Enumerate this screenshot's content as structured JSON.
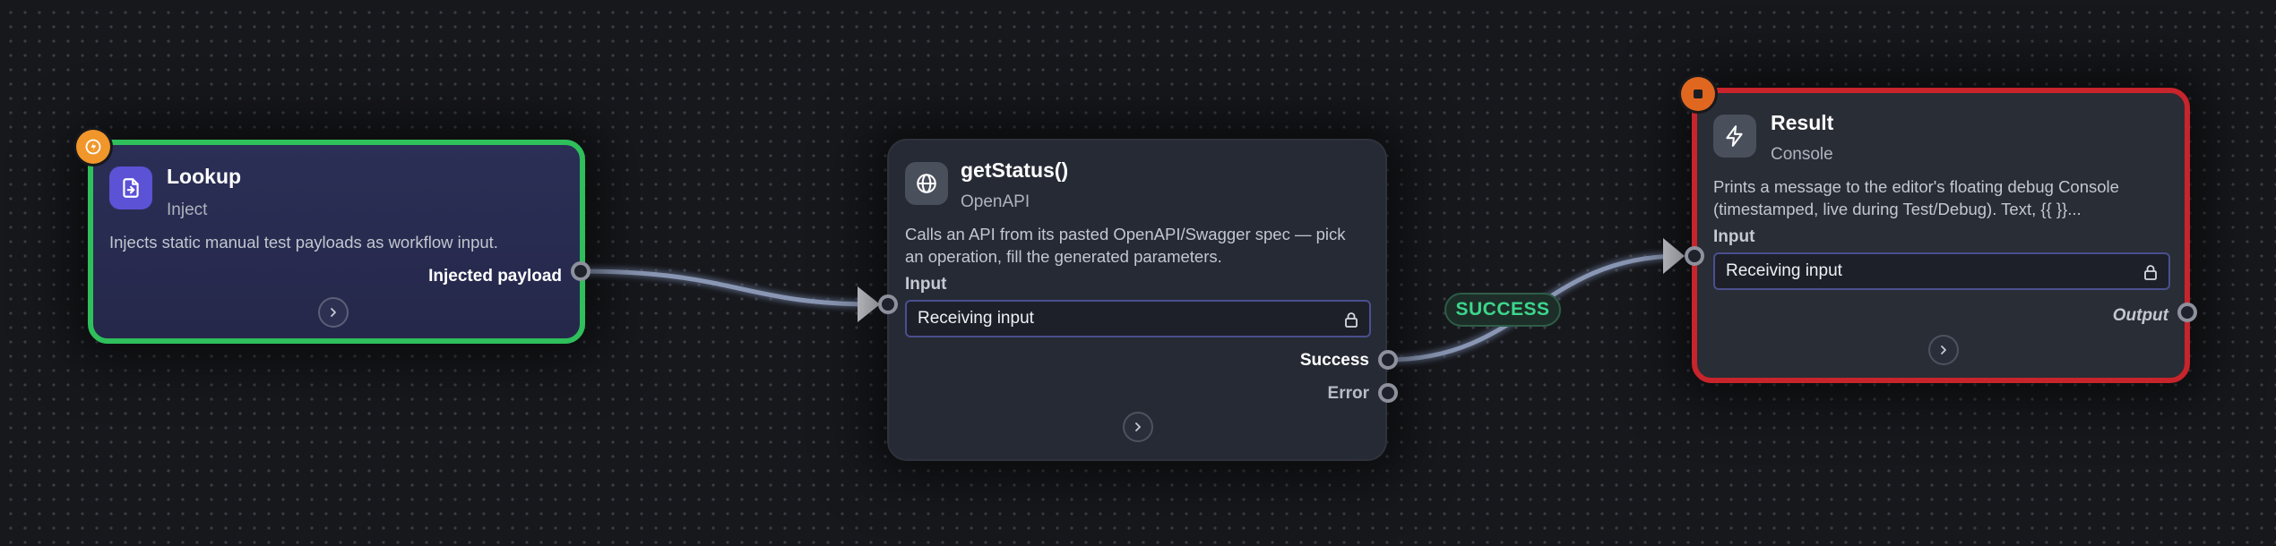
{
  "nodes": {
    "inject": {
      "title": "Lookup",
      "type": "Inject",
      "description": "Injects static manual test payloads as workflow input.",
      "output_label": "Injected payload",
      "icon": "file-import-icon",
      "border_color": "#2fbf5b",
      "badge_icon": "lightning-badge-icon"
    },
    "openapi": {
      "title": "getStatus()",
      "type": "OpenAPI",
      "description_line1": "Calls an API from its pasted OpenAPI/Swagger spec — pick",
      "description_line2": "an operation, fill the generated parameters.",
      "input_label": "Input",
      "input_value": "Receiving input",
      "outputs": [
        "Success",
        "Error"
      ],
      "icon": "globe-icon"
    },
    "console": {
      "title": "Result",
      "type": "Console",
      "description_line1": "Prints a message to the editor's floating debug Console",
      "description_line2": "(timestamped, live during Test/Debug). Text, {{ }}...",
      "input_label": "Input",
      "input_value": "Receiving input",
      "output_label": "Output",
      "icon": "lightning-icon",
      "border_color": "#c8242b",
      "badge_icon": "stop-badge-icon"
    }
  },
  "edges": [
    {
      "from": "Lookup.Injected payload",
      "to": "getStatus().Input"
    },
    {
      "from": "getStatus().Success",
      "to": "Result.Input",
      "label": "SUCCESS"
    }
  ],
  "colors": {
    "success": "#3dd68c",
    "inject_border": "#2fbf5b",
    "console_border": "#c8242b",
    "badge_orange": "#f0962a"
  }
}
